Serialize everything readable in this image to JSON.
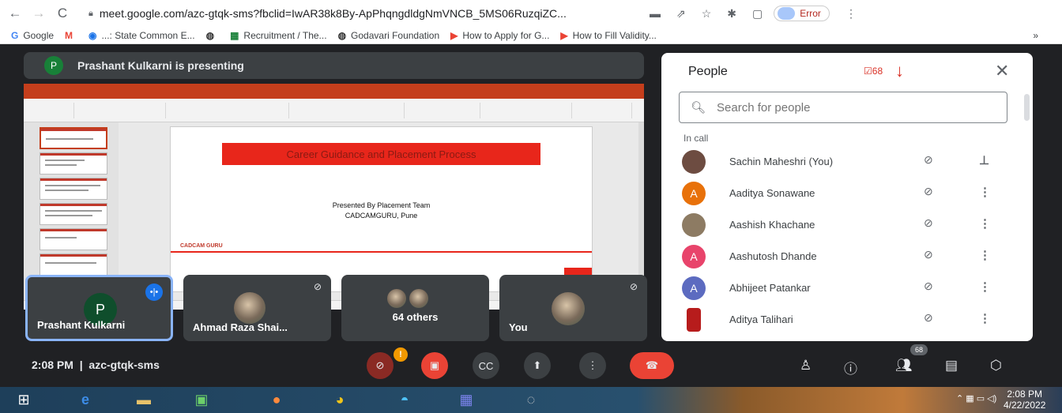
{
  "browser": {
    "url": "meet.google.com/azc-gtqk-sms?fbclid=IwAR38k8By-ApPhqngdldgNmVNCB_5MS06RuzqiZC...",
    "error_label": "Error",
    "bookmarks": [
      "Google",
      "",
      "...: State Common E...",
      "",
      "Recruitment / The...",
      "Godavari Foundation",
      "How to Apply for G...",
      "How to Fill Validity..."
    ]
  },
  "presenting_banner": {
    "avatar_letter": "P",
    "text": "Prashant Kulkarni is presenting"
  },
  "slide": {
    "title": "Career Guidance and Placement Process",
    "subtitle1": "Presented By Placement Team",
    "subtitle2": "CADCAMGURU, Pune",
    "logo": "CADCAM GURU"
  },
  "tiles": [
    {
      "name": "Prashant Kulkarni",
      "avatar": "P"
    },
    {
      "name": "Ahmad Raza Shai..."
    },
    {
      "name": "64 others"
    },
    {
      "name": "You"
    }
  ],
  "people": {
    "heading": "People",
    "count": "68",
    "search_placeholder": "Search for people",
    "section": "In call",
    "list": [
      {
        "name": "Sachin Maheshri (You)",
        "color": "#6d4c41",
        "initial": ""
      },
      {
        "name": "Aaditya Sonawane",
        "color": "#e8710a",
        "initial": "A"
      },
      {
        "name": "Aashish Khachane",
        "color": "#8d7b63",
        "initial": ""
      },
      {
        "name": "Aashutosh Dhande",
        "color": "#e8446b",
        "initial": "A"
      },
      {
        "name": "Abhijeet Patankar",
        "color": "#5c6bc0",
        "initial": "A"
      },
      {
        "name": "Aditya Talihari",
        "color": "#b71c1c",
        "initial": ""
      }
    ]
  },
  "bottom": {
    "time": "2:08 PM",
    "meeting_code": "azc-gtqk-sms",
    "mic_badge": "!",
    "people_count": "68"
  },
  "taskbar": {
    "time": "2:08 PM",
    "date": "4/22/2022"
  }
}
